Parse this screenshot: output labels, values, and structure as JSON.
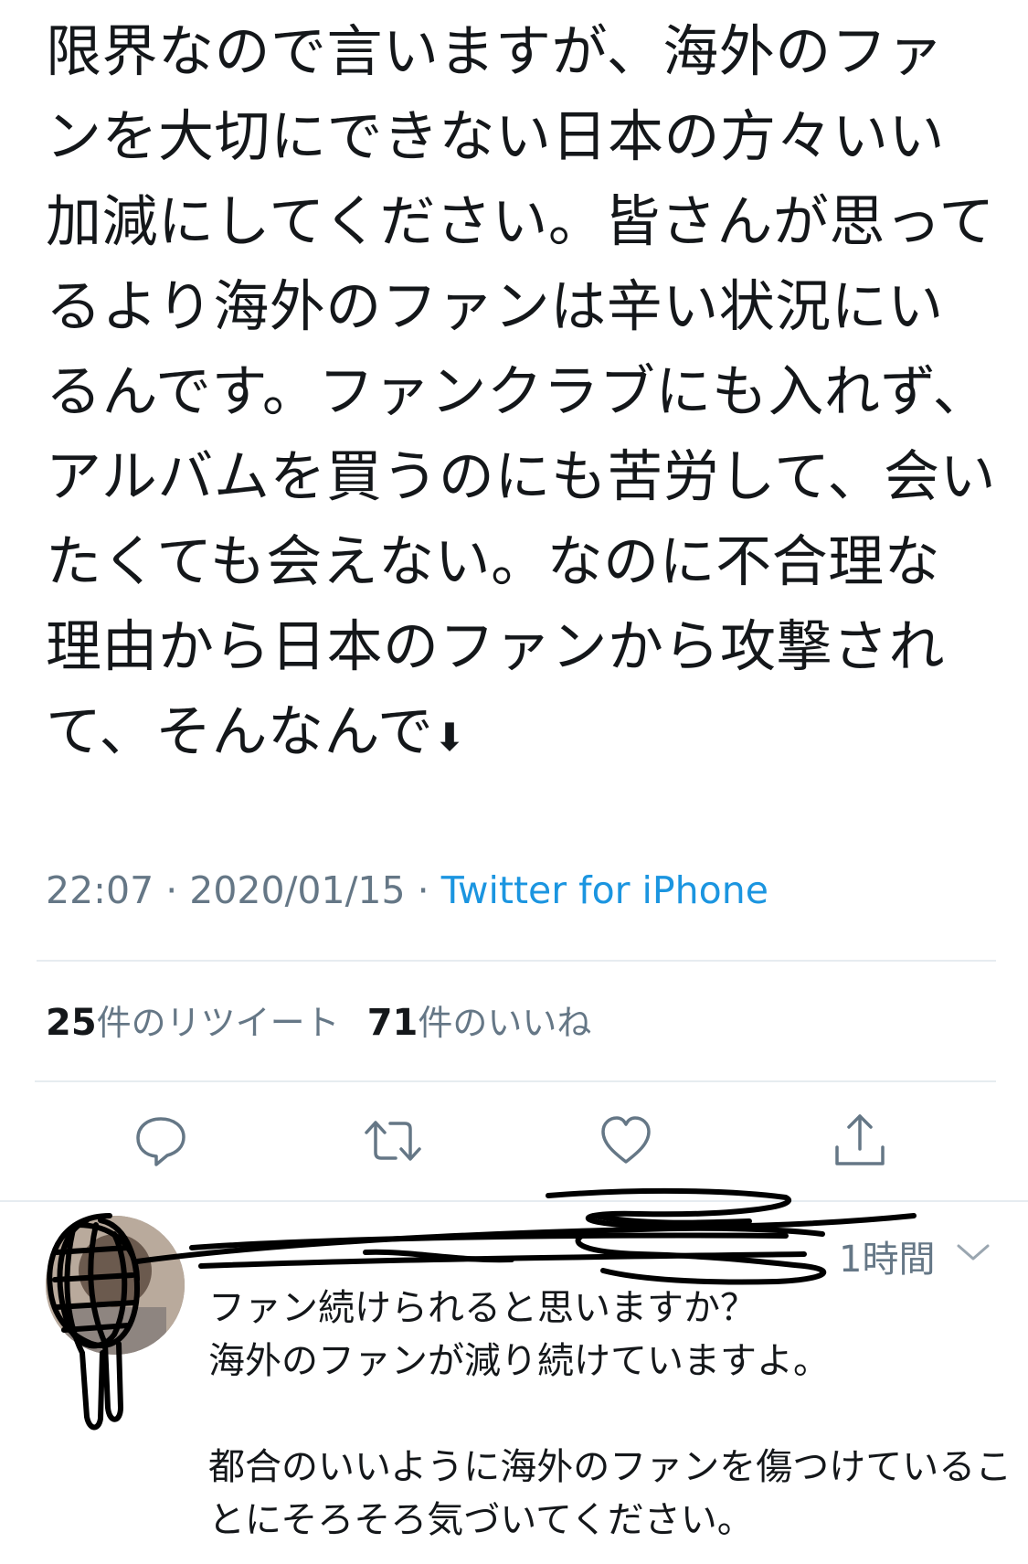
{
  "tweet": {
    "text": "限界なので言いますが、海外のファンを大切にできない日本の方々いい加減にしてください。皆さんが思ってるより海外のファンは辛い状況にいるんです。ファンクラブにも入れず、アルバムを買うのにも苦労して、会いたくても会えない。なのに不合理な理由から日本のファンから攻撃されて、そんなんで",
    "arrow_emoji": "⬇",
    "time": "22:07",
    "date": "2020/01/15",
    "separator": " · ",
    "source": "Twitter for iPhone"
  },
  "stats": {
    "retweets_count": "25",
    "retweets_label": "件のリツイート",
    "likes_count": "71",
    "likes_label": "件のいいね"
  },
  "actions": {
    "icons": [
      "reply-icon",
      "retweet-icon",
      "like-icon",
      "share-icon"
    ]
  },
  "reply": {
    "time": "1時間",
    "text": "ファン続けられると思いますか？\n海外のファンが減り続けていますよ。\n\n都合のいいように海外のファンを傷つけていることにそろそろ気づいてください。"
  },
  "colors": {
    "text": "#14171a",
    "secondary": "#657786",
    "link": "#1b95e0",
    "divider": "#e6ecf0"
  }
}
